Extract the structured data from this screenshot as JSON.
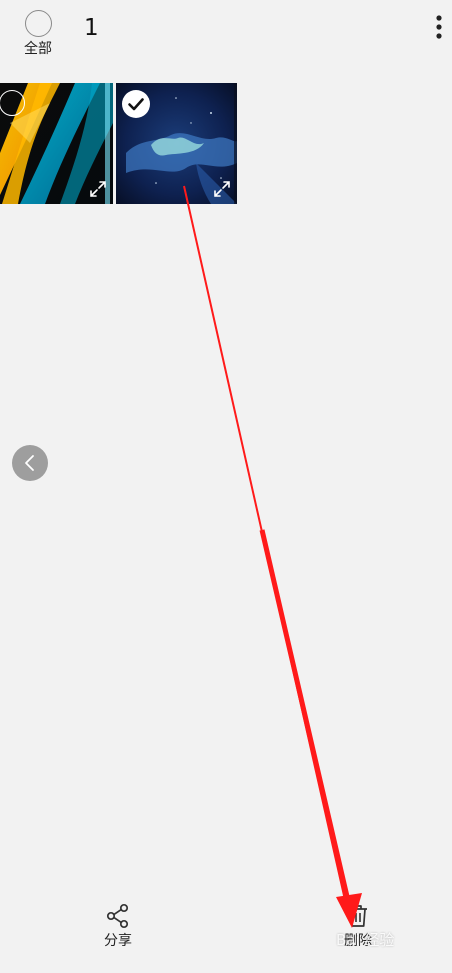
{
  "header": {
    "select_all_label": "全部",
    "selected_count": "1"
  },
  "gallery": {
    "items": [
      {
        "selected": false
      },
      {
        "selected": true
      }
    ]
  },
  "bottom_bar": {
    "share_label": "分享",
    "delete_label": "删除"
  },
  "watermark": {
    "text": "Bai 经验"
  },
  "colors": {
    "background": "#f2f2f2",
    "annotation_arrow": "#ff1a1a"
  }
}
